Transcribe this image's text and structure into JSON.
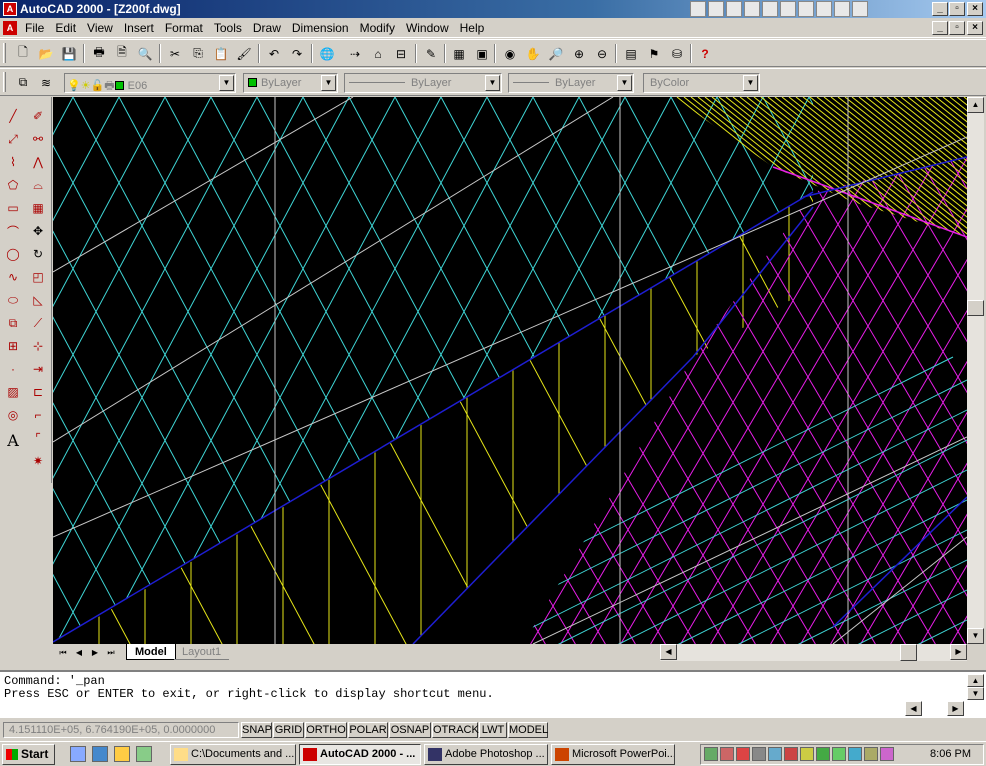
{
  "window": {
    "title": "AutoCAD 2000 - [Z200f.dwg]",
    "app_glyph": "A"
  },
  "menu": [
    "File",
    "Edit",
    "View",
    "Insert",
    "Format",
    "Tools",
    "Draw",
    "Dimension",
    "Modify",
    "Window",
    "Help"
  ],
  "layers_toolbar": {
    "layer": "E06",
    "color": "ByLayer",
    "linetype": "ByLayer",
    "lineweight": "ByLayer",
    "plotstyle": "ByColor"
  },
  "tabs": {
    "model": "Model",
    "layout1": "Layout1"
  },
  "command": {
    "line1": "Command: '_pan",
    "line2": "Press ESC or ENTER to exit, or right-click to display shortcut menu."
  },
  "status": {
    "coords": "4.151110E+05, 6.764190E+05, 0.0000000",
    "buttons": [
      "SNAP",
      "GRID",
      "ORTHO",
      "POLAR",
      "OSNAP",
      "OTRACK",
      "LWT",
      "MODEL"
    ]
  },
  "taskbar": {
    "start": "Start",
    "tasks": [
      "C:\\Documents and ...",
      "AutoCAD 2000 - ...",
      "Adobe Photoshop ...",
      "Microsoft PowerPoi..."
    ],
    "clock": "8:06 PM"
  },
  "colors": {
    "cyan": "#3fd6d6",
    "yellow": "#e6e619",
    "magenta": "#e61ee6",
    "blue": "#1e1ed2",
    "white": "#c8c8c8",
    "green": "#3cd23c"
  }
}
